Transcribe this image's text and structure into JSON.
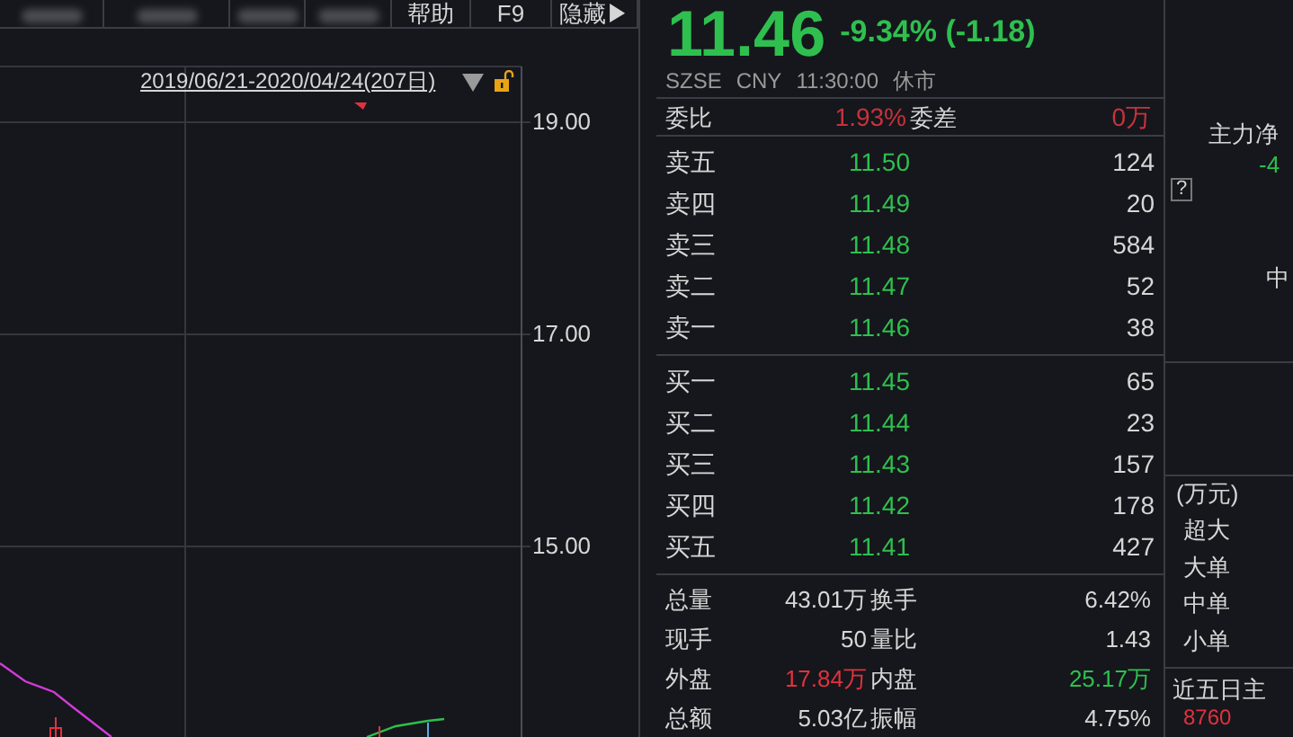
{
  "tabs": [
    {
      "kind": "blurred"
    },
    {
      "kind": "blurred"
    },
    {
      "kind": "blurred"
    },
    {
      "kind": "blurred"
    },
    {
      "kind": "text",
      "label": "帮助"
    },
    {
      "kind": "text",
      "label": "F9"
    },
    {
      "kind": "text",
      "label": "隐藏▶"
    }
  ],
  "chart": {
    "range_label": "2019/06/21-2020/04/24(207日)",
    "price_labels": [
      "19.00",
      "17.00",
      "15.00"
    ]
  },
  "quote": {
    "price": "11.46",
    "change": "-9.34% (-1.18)",
    "color": "#2fbf4f",
    "exchange": "SZSE",
    "currency": "CNY",
    "time": "11:30:00",
    "status": "休市"
  },
  "commission": [
    {
      "label": "委比",
      "value": "1.93%",
      "color": "#c8323c"
    },
    {
      "label": "委差",
      "value": "0万",
      "color": "#c8323c"
    }
  ],
  "asks": [
    {
      "label": "卖五",
      "price": "11.50",
      "volume": "124"
    },
    {
      "label": "卖四",
      "price": "11.49",
      "volume": "20"
    },
    {
      "label": "卖三",
      "price": "11.48",
      "volume": "584"
    },
    {
      "label": "卖二",
      "price": "11.47",
      "volume": "52"
    },
    {
      "label": "卖一",
      "price": "11.46",
      "volume": "38"
    }
  ],
  "bids": [
    {
      "label": "买一",
      "price": "11.45",
      "volume": "65"
    },
    {
      "label": "买二",
      "price": "11.44",
      "volume": "23"
    },
    {
      "label": "买三",
      "price": "11.43",
      "volume": "157"
    },
    {
      "label": "买四",
      "price": "11.42",
      "volume": "178"
    },
    {
      "label": "买五",
      "price": "11.41",
      "volume": "427"
    }
  ],
  "stats": [
    {
      "label": "总量",
      "value": "43.01万"
    },
    {
      "label": "换手",
      "value": "6.42%"
    },
    {
      "label": "现手",
      "value": "50"
    },
    {
      "label": "量比",
      "value": "1.43"
    },
    {
      "label": "外盘",
      "value": "17.84万",
      "color": "#e0323e"
    },
    {
      "label": "内盘",
      "value": "25.17万",
      "color": "#2fbf4f"
    },
    {
      "label": "总额",
      "value": "5.03亿"
    },
    {
      "label": "振幅",
      "value": "4.75%"
    }
  ],
  "fund_flow": {
    "title": "主力净",
    "value": "-4",
    "color": "#2fbf4f",
    "help": "?",
    "mid_label": "中",
    "unit": "(万元)",
    "categories": [
      "超大",
      "大单",
      "中单",
      "小单"
    ],
    "five_day": {
      "title": "近五日主",
      "value": "8760",
      "color": "#e0323e"
    }
  }
}
